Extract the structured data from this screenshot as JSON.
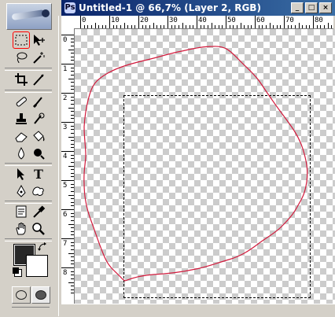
{
  "app": {
    "name": "Adobe Photoshop"
  },
  "document": {
    "title": "Untitled-1 @ 66,7% (Layer 2, RGB)",
    "window_buttons": [
      "_",
      "□",
      "×"
    ]
  },
  "ruler": {
    "horizontal_labels": [
      "0",
      "10",
      "20",
      "30",
      "40",
      "50",
      "60",
      "70",
      "80"
    ],
    "vertical_labels": [
      "0",
      "1",
      "2",
      "3",
      "4",
      "5",
      "6",
      "7",
      "8"
    ]
  },
  "tools": [
    "rectangular-marquee",
    "move",
    "lasso",
    "magic-wand",
    "crop",
    "slice",
    "healing-brush",
    "brush",
    "clone-stamp",
    "history-brush",
    "eraser",
    "paint-bucket",
    "blur",
    "dodge",
    "path-selection",
    "type",
    "pen",
    "custom-shape",
    "notes",
    "eyedropper",
    "hand",
    "zoom"
  ],
  "colors": {
    "foreground": "#282828",
    "background": "#ffffff",
    "selection_outline": "#d21a3c",
    "titlebar": "#0a246a"
  },
  "active_tool": "rectangular-marquee"
}
